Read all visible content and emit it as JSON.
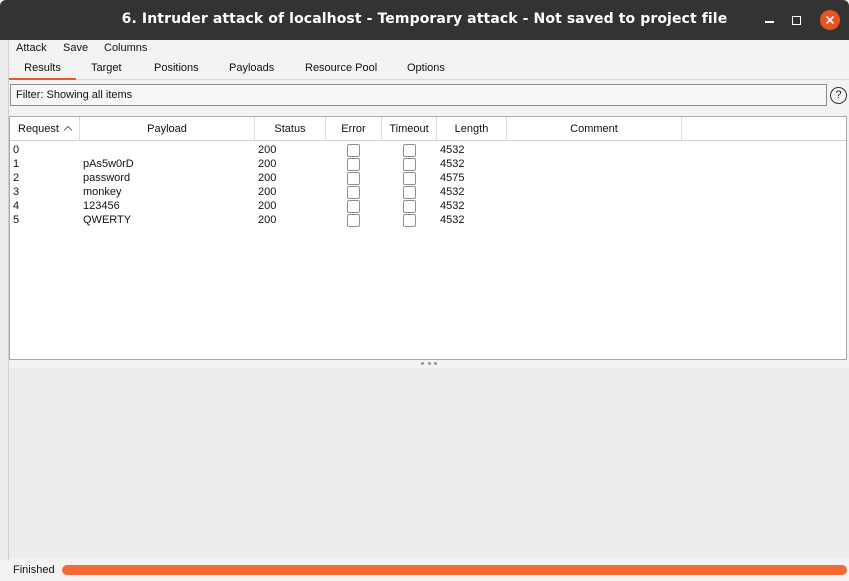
{
  "window": {
    "title": "6. Intruder attack of localhost - Temporary attack - Not saved to project file",
    "accent_color": "#e95420"
  },
  "menu": [
    "Attack",
    "Save",
    "Columns"
  ],
  "tabs": [
    {
      "label": "Results",
      "active": true
    },
    {
      "label": "Target"
    },
    {
      "label": "Positions"
    },
    {
      "label": "Payloads"
    },
    {
      "label": "Resource Pool"
    },
    {
      "label": "Options"
    }
  ],
  "filter": {
    "text": "Filter: Showing all items",
    "help_label": "?"
  },
  "table": {
    "columns": [
      "Request",
      "Payload",
      "Status",
      "Error",
      "Timeout",
      "Length",
      "Comment"
    ],
    "sorted_column": "Request",
    "rows": [
      {
        "request": "0",
        "payload": "",
        "status": "200",
        "error": false,
        "timeout": false,
        "length": "4532",
        "comment": ""
      },
      {
        "request": "1",
        "payload": "pAs5w0rD",
        "status": "200",
        "error": false,
        "timeout": false,
        "length": "4532",
        "comment": ""
      },
      {
        "request": "2",
        "payload": "password",
        "status": "200",
        "error": false,
        "timeout": false,
        "length": "4575",
        "comment": ""
      },
      {
        "request": "3",
        "payload": "monkey",
        "status": "200",
        "error": false,
        "timeout": false,
        "length": "4532",
        "comment": ""
      },
      {
        "request": "4",
        "payload": "123456",
        "status": "200",
        "error": false,
        "timeout": false,
        "length": "4532",
        "comment": ""
      },
      {
        "request": "5",
        "payload": "QWERTY",
        "status": "200",
        "error": false,
        "timeout": false,
        "length": "4532",
        "comment": ""
      }
    ]
  },
  "status": {
    "text": "Finished",
    "progress_percent": 100,
    "progress_color": "#f26a35"
  }
}
